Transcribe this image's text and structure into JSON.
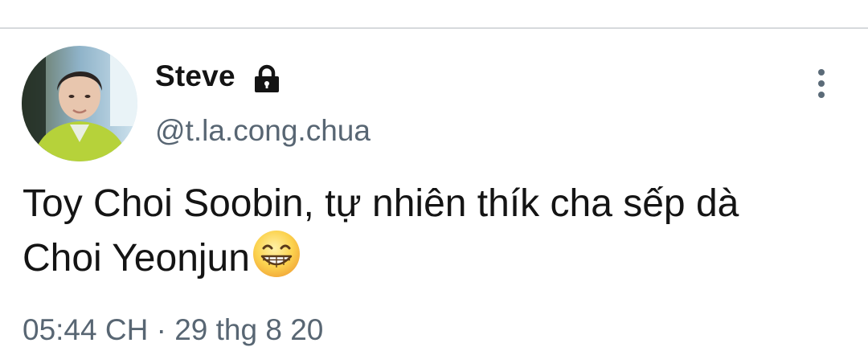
{
  "tweet": {
    "author": {
      "display_name": "Steve",
      "handle": "@t.la.cong.chua",
      "protected_icon": "lock-icon",
      "avatar": "avatar-photo"
    },
    "text": {
      "line1": "Toy Choi Soobin, tự nhiên thík cha sếp dà",
      "line2": "Choi Yeonjun",
      "emoji": "grinning-face-with-smiling-eyes"
    },
    "meta": {
      "timestamp_partial": "05:44 CH · 29 thg 8 20"
    },
    "more_icon": "more-vertical-icon"
  },
  "colors": {
    "text_primary": "#141414",
    "text_secondary": "#586673",
    "divider": "#d6d9dc"
  }
}
